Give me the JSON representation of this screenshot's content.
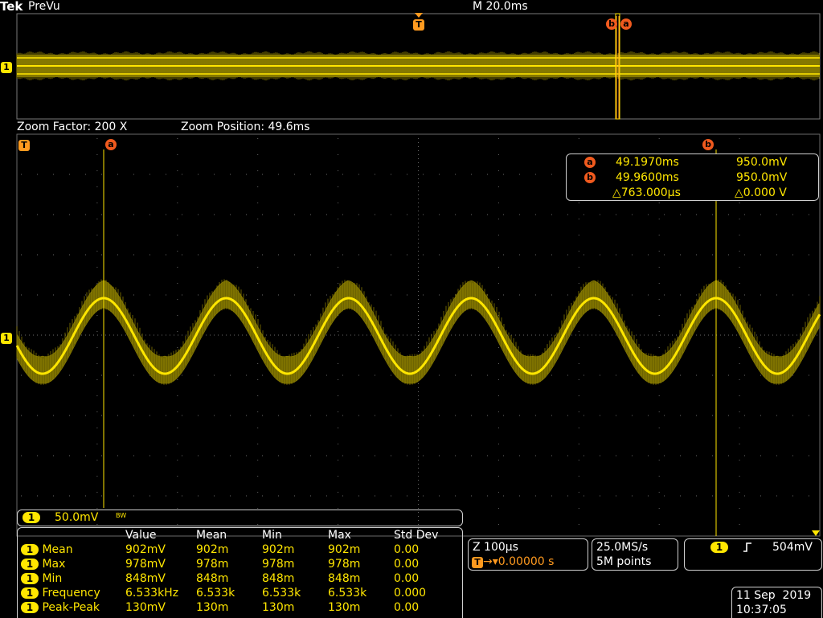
{
  "brand": "Tek",
  "mode": "PreVu",
  "timebase": "M 20.0ms",
  "trigger_marker": "T",
  "channel_marker": "1",
  "cursor_labels": {
    "a": "a",
    "b": "b"
  },
  "zoom": {
    "factor_label": "Zoom Factor: 200 X",
    "position_label": "Zoom Position: 49.6ms"
  },
  "cursor_readout": {
    "a_time": "49.1970ms",
    "a_volt": "950.0mV",
    "b_time": "49.9600ms",
    "b_volt": "950.0mV",
    "delta_time": "△763.000µs",
    "delta_volt": "△0.000 V"
  },
  "channel_scale": {
    "channel": "1",
    "scale": "50.0mV",
    "bw": "BW"
  },
  "measurements": {
    "headers": [
      "Value",
      "Mean",
      "Min",
      "Max",
      "Std Dev"
    ],
    "rows": [
      {
        "ch": "1",
        "name": "Mean",
        "value": "902mV",
        "mean": "902m",
        "min": "902m",
        "max": "902m",
        "std": "0.00"
      },
      {
        "ch": "1",
        "name": "Max",
        "value": "978mV",
        "mean": "978m",
        "min": "978m",
        "max": "978m",
        "std": "0.00"
      },
      {
        "ch": "1",
        "name": "Min",
        "value": "848mV",
        "mean": "848m",
        "min": "848m",
        "max": "848m",
        "std": "0.00"
      },
      {
        "ch": "1",
        "name": "Frequency",
        "value": "6.533kHz",
        "mean": "6.533k",
        "min": "6.533k",
        "max": "6.533k",
        "std": "0.000"
      },
      {
        "ch": "1",
        "name": "Peak-Peak",
        "value": "130mV",
        "mean": "130m",
        "min": "130m",
        "max": "130m",
        "std": "0.00"
      }
    ]
  },
  "zoom_timebase": {
    "scale": "Z 100µs",
    "trigger_position": "0.00000 s"
  },
  "acquisition": {
    "sample_rate": "25.0MS/s",
    "record_length": "5M points"
  },
  "trigger": {
    "channel": "1",
    "slope_icon": "rising-edge",
    "level": "504mV"
  },
  "datetime": {
    "date": "11 Sep  2019",
    "time": "10:37:05"
  },
  "colors": {
    "trace": "#ffe600",
    "cursor": "#ff9a1f",
    "marker": "#f05a1e",
    "grid": "#6a6a6a"
  }
}
